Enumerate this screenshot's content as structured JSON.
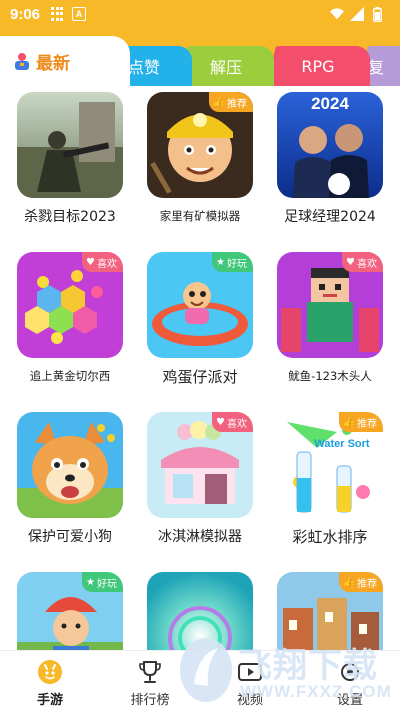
{
  "status_bar": {
    "time": "9:06",
    "a_label": "A"
  },
  "tabs": {
    "active": "最新",
    "items": [
      "点赞",
      "解压",
      "RPG",
      "复"
    ]
  },
  "games": [
    {
      "title": "杀戮目标2023",
      "badge": null
    },
    {
      "title": "家里有矿模拟器",
      "badge": "推荐"
    },
    {
      "title": "足球经理2024",
      "badge": null,
      "thumb_text": "2024"
    },
    {
      "title": "追上黄金切尔西",
      "badge": "喜欢"
    },
    {
      "title": "鸡蛋仔派对",
      "badge": "好玩"
    },
    {
      "title": "鱿鱼-123木头人",
      "badge": "喜欢"
    },
    {
      "title": "保护可爱小狗",
      "badge": null
    },
    {
      "title": "冰淇淋模拟器",
      "badge": "喜欢"
    },
    {
      "title": "彩虹水排序",
      "badge": "推荐",
      "thumb_text": "Water Sort"
    },
    {
      "title": "",
      "badge": "好玩"
    },
    {
      "title": "",
      "badge": null
    },
    {
      "title": "",
      "badge": "推荐"
    }
  ],
  "bottom_nav": {
    "items": [
      {
        "label": "手游",
        "icon": "gamepad-face-icon",
        "active": true
      },
      {
        "label": "排行榜",
        "icon": "trophy-icon",
        "active": false
      },
      {
        "label": "视频",
        "icon": "video-icon",
        "active": false
      },
      {
        "label": "设置",
        "icon": "settings-icon",
        "active": false
      }
    ]
  },
  "watermark": {
    "brand": "飞翔下载",
    "url": "WWW.FXXZ.COM"
  },
  "colors": {
    "accent": "#f7b928",
    "active_tab_text": "#f08a1c",
    "tab_dianzan": "#22b1e8",
    "tab_jieya": "#9ccd3c",
    "tab_rpg": "#f34f6c",
    "badge_recommend": "#f6a623",
    "badge_like": "#f2627f",
    "badge_fun": "#41c77a"
  }
}
